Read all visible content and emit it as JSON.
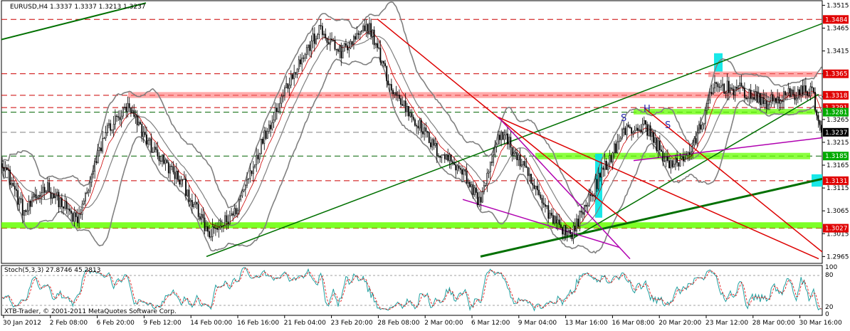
{
  "chart_data": {
    "type": "candlestick",
    "main_header": "EURUSD,H4  1.3337 1.3337 1.3213 1.3237",
    "stoch_header": "Stoch(5,3,3) 27.8746 45.2813",
    "copyright": "XTB-Trader, © 2001-2011 MetaQuotes Software Corp.",
    "price_ticks": [
      "1.3515",
      "1.3465",
      "1.3415",
      "1.3365",
      "1.3315",
      "1.3265",
      "1.3215",
      "1.3165",
      "1.3115",
      "1.3065",
      "1.3015",
      "1.2965"
    ],
    "price_ylim": [
      1.295,
      1.3525
    ],
    "price_levels": [
      {
        "label": "1.3484",
        "value": 1.3484,
        "kind": "red-box"
      },
      {
        "label": "1.3365",
        "value": 1.3365,
        "kind": "red-box"
      },
      {
        "label": "1.3318",
        "value": 1.3318,
        "kind": "red-box"
      },
      {
        "label": "1.3291",
        "value": 1.3291,
        "kind": "red-box"
      },
      {
        "label": "1.3281",
        "value": 1.3281,
        "kind": "green-box"
      },
      {
        "label": "1.3237",
        "value": 1.3237,
        "kind": "black-box"
      },
      {
        "label": "1.3185",
        "value": 1.3185,
        "kind": "green-box"
      },
      {
        "label": "1.3131",
        "value": 1.3131,
        "kind": "red-box"
      },
      {
        "label": "1.3027",
        "value": 1.3027,
        "kind": "red-box"
      }
    ],
    "stoch_ticks": [
      "100",
      "80",
      "20",
      "0"
    ],
    "stoch_levels": [
      80,
      20
    ],
    "time_labels": [
      "30 Jan 2012",
      "2 Feb 08:00",
      "6 Feb 20:00",
      "9 Feb 12:00",
      "14 Feb 00:00",
      "16 Feb 16:00",
      "21 Feb 04:00",
      "23 Feb 20:00",
      "28 Feb 08:00",
      "2 Mar 00:00",
      "6 Mar 12:00",
      "9 Mar 04:00",
      "13 Mar 16:00",
      "16 Mar 08:00",
      "20 Mar 20:00",
      "23 Mar 12:00",
      "28 Mar 00:00",
      "30 Mar 16:00"
    ],
    "pattern_labels": [
      "S",
      "H",
      "S"
    ],
    "anchors": [
      [
        0,
        1.3175
      ],
      [
        14,
        1.306
      ],
      [
        28,
        1.312
      ],
      [
        48,
        1.304
      ],
      [
        66,
        1.324
      ],
      [
        80,
        1.329
      ],
      [
        96,
        1.32
      ],
      [
        116,
        1.312
      ],
      [
        132,
        1.301
      ],
      [
        148,
        1.306
      ],
      [
        166,
        1.322
      ],
      [
        184,
        1.336
      ],
      [
        202,
        1.346
      ],
      [
        216,
        1.341
      ],
      [
        234,
        1.347
      ],
      [
        248,
        1.333
      ],
      [
        262,
        1.327
      ],
      [
        276,
        1.32
      ],
      [
        292,
        1.316
      ],
      [
        304,
        1.3085
      ],
      [
        318,
        1.324
      ],
      [
        332,
        1.316
      ],
      [
        346,
        1.307
      ],
      [
        362,
        1.301
      ],
      [
        378,
        1.312
      ],
      [
        396,
        1.324
      ],
      [
        410,
        1.325
      ],
      [
        426,
        1.316
      ],
      [
        440,
        1.32
      ],
      [
        454,
        1.334
      ],
      [
        470,
        1.333
      ],
      [
        486,
        1.33
      ],
      [
        502,
        1.332
      ],
      [
        516,
        1.333
      ],
      [
        522,
        1.3237
      ]
    ]
  }
}
